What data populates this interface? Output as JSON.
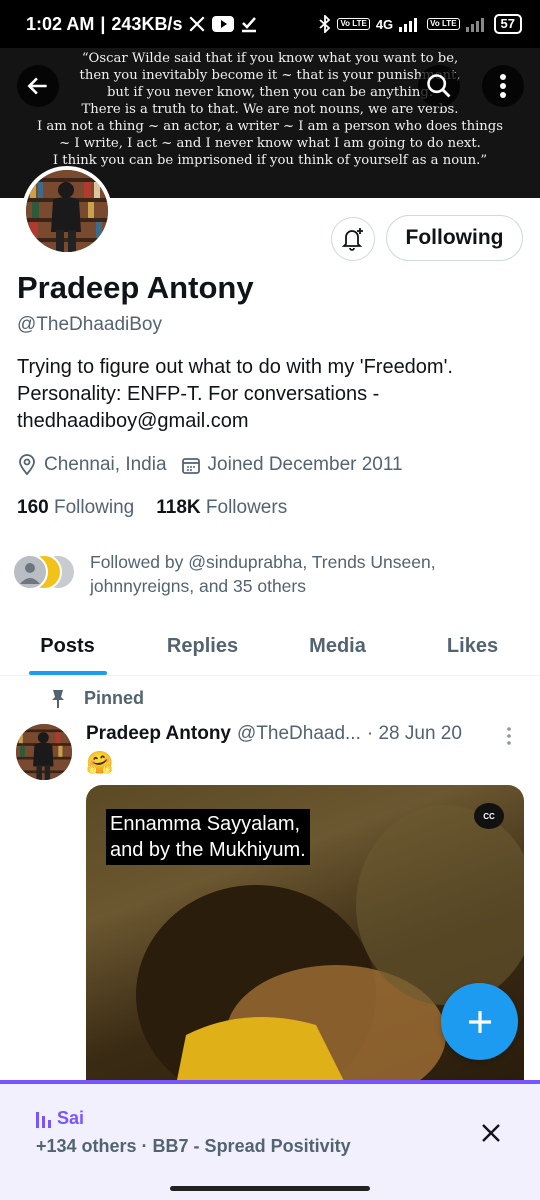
{
  "status_bar": {
    "time": "1:02 AM",
    "speed": "243KB/s",
    "icons": [
      "x-icon",
      "youtube-icon",
      "download-done-icon"
    ],
    "right_icons": [
      "bluetooth-icon",
      "volte-icon",
      "signal-4g-icon",
      "volte-icon",
      "signal-icon"
    ],
    "network_label": "4G",
    "volte_label": "Vo LTE",
    "battery": "57"
  },
  "banner": {
    "quote_lines": [
      "“Oscar Wilde said that if you know what you want to be,",
      "then you inevitably become it ~ that is your punishment,",
      "but if you never know, then you can be anything.",
      "There is a truth to that. We are not nouns, we are verbs.",
      "I am not a thing ~ an actor, a writer ~ I am a person who does things",
      "~ I write, I act ~ and I never know what I am going to do next.",
      "I think you can be imprisoned if you think of yourself as a noun.”"
    ]
  },
  "profile": {
    "name": "Pradeep Antony",
    "handle": "@TheDhaadiBoy",
    "bio": "Trying to figure out what to do with my 'Freedom'. Personality: ENFP-T.  For conversations - thedhaadiboy@gmail.com",
    "location": "Chennai, India",
    "joined": "Joined December 2011",
    "following_count": "160",
    "following_label": "Following",
    "followers_count": "118K",
    "followers_label": "Followers",
    "follow_button": "Following",
    "followed_by": "Followed by @sinduprabha, Trends Unseen, johnnyreigns, and 35 others"
  },
  "tabs": [
    {
      "label": "Posts",
      "active": true
    },
    {
      "label": "Replies",
      "active": false
    },
    {
      "label": "Media",
      "active": false
    },
    {
      "label": "Likes",
      "active": false
    }
  ],
  "post": {
    "pinned_label": "Pinned",
    "author": "Pradeep Antony",
    "handle": "@TheDhaad...",
    "date": "· 28 Jun 20",
    "emoji": "🤗",
    "subtitle_line1": "Ennamma Sayyalam,",
    "subtitle_line2": "and by the Mukhiyum.",
    "cc_label": "CC"
  },
  "spaces": {
    "host": "Sai",
    "title": "+134 others · BB7 - Spread Positivity"
  },
  "colors": {
    "accent": "#1d9bf0",
    "spaces": "#7856ff",
    "secondary_text": "#536471"
  }
}
